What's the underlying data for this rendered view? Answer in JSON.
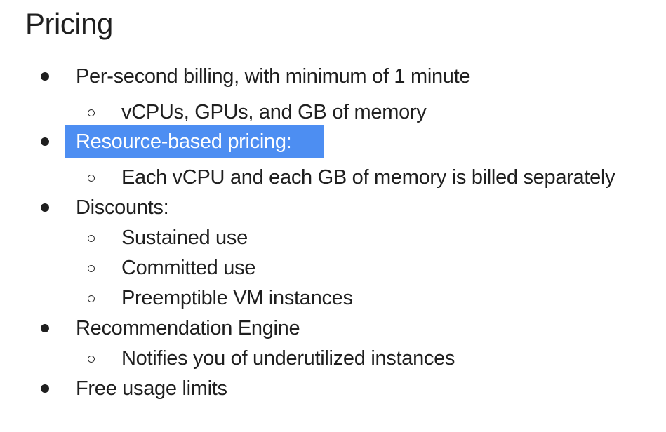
{
  "title": "Pricing",
  "bullets": [
    {
      "level": 1,
      "text": "Per-second billing, with minimum of 1 minute"
    },
    {
      "level": 2,
      "text": "vCPUs, GPUs, and GB of memory"
    },
    {
      "level": 1,
      "text": "Resource-based pricing:",
      "highlighted": true
    },
    {
      "level": 2,
      "text": "Each vCPU and each GB of memory is billed separately"
    },
    {
      "level": 1,
      "text": "Discounts:"
    },
    {
      "level": 2,
      "text": "Sustained use"
    },
    {
      "level": 2,
      "text": "Committed use"
    },
    {
      "level": 2,
      "text": "Preemptible VM instances"
    },
    {
      "level": 1,
      "text": "Recommendation Engine"
    },
    {
      "level": 2,
      "text": "Notifies you of underutilized instances"
    },
    {
      "level": 1,
      "text": "Free usage limits"
    }
  ],
  "colors": {
    "text": "#1f1f1f",
    "highlight": "#4d8ef2",
    "highlight_text": "#ffffff",
    "background": "#ffffff"
  }
}
